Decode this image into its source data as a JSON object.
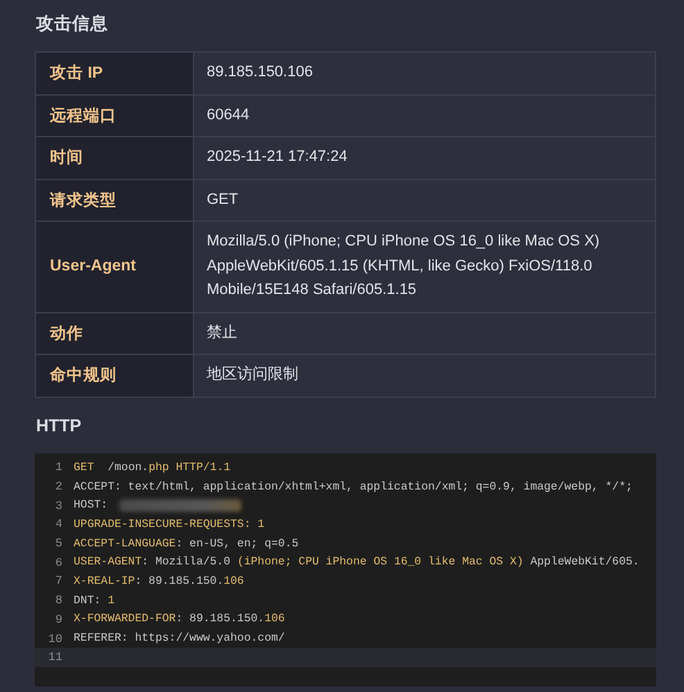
{
  "attack_info": {
    "title": "攻击信息",
    "rows": [
      {
        "label": "攻击 IP",
        "value": "89.185.150.106"
      },
      {
        "label": "远程端口",
        "value": "60644"
      },
      {
        "label": "时间",
        "value": "2025-11-21 17:47:24"
      },
      {
        "label": "请求类型",
        "value": "GET"
      },
      {
        "label": "User-Agent",
        "value": "Mozilla/5.0 (iPhone; CPU iPhone OS 16_0 like Mac OS X) AppleWebKit/605.1.15 (KHTML, like Gecko) FxiOS/118.0 Mobile/15E148 Safari/605.1.15"
      },
      {
        "label": "动作",
        "value": "禁止"
      },
      {
        "label": "命中规则",
        "value": "地区访问限制"
      }
    ]
  },
  "http": {
    "title": "HTTP",
    "lines": [
      {
        "number": "1",
        "current": false,
        "redacted": false,
        "segments": [
          {
            "text": "GET",
            "highlight": true
          },
          {
            "text": "  /moon.",
            "highlight": false
          },
          {
            "text": "php HTTP/1.1",
            "highlight": true
          }
        ]
      },
      {
        "number": "2",
        "current": false,
        "redacted": false,
        "segments": [
          {
            "text": "ACCEPT: text/html, application/xhtml+xml, application/xml; q=0.9, image/webp, */*;",
            "highlight": false
          }
        ]
      },
      {
        "number": "3",
        "current": false,
        "redacted": true,
        "segments": [
          {
            "text": "HOST:",
            "highlight": false
          }
        ]
      },
      {
        "number": "4",
        "current": false,
        "redacted": false,
        "segments": [
          {
            "text": "UPGRADE-INSECURE-REQUESTS: 1",
            "highlight": true
          }
        ]
      },
      {
        "number": "5",
        "current": false,
        "redacted": false,
        "segments": [
          {
            "text": "ACCEPT-LANGUAGE",
            "highlight": true
          },
          {
            "text": ": en-US, en; q=0.5",
            "highlight": false
          }
        ]
      },
      {
        "number": "6",
        "current": false,
        "redacted": false,
        "segments": [
          {
            "text": "USER-AGENT",
            "highlight": true
          },
          {
            "text": ": Mozilla/5.0 ",
            "highlight": false
          },
          {
            "text": "(iPhone; CPU iPhone OS 16_0 like Mac OS X)",
            "highlight": true
          },
          {
            "text": " AppleWebKit/605.",
            "highlight": false
          }
        ]
      },
      {
        "number": "7",
        "current": false,
        "redacted": false,
        "segments": [
          {
            "text": "X-REAL-IP",
            "highlight": true
          },
          {
            "text": ": 89.185.150.",
            "highlight": false
          },
          {
            "text": "106",
            "highlight": true
          }
        ]
      },
      {
        "number": "8",
        "current": false,
        "redacted": false,
        "segments": [
          {
            "text": "DNT: ",
            "highlight": false
          },
          {
            "text": "1",
            "highlight": true
          }
        ]
      },
      {
        "number": "9",
        "current": false,
        "redacted": false,
        "segments": [
          {
            "text": "X-FORWARDED-FOR",
            "highlight": true
          },
          {
            "text": ": 89.185.150.",
            "highlight": false
          },
          {
            "text": "106",
            "highlight": true
          }
        ]
      },
      {
        "number": "10",
        "current": false,
        "redacted": false,
        "segments": [
          {
            "text": "REFERER: https://www.yahoo.com/",
            "highlight": false
          }
        ]
      },
      {
        "number": "11",
        "current": true,
        "redacted": false
      }
    ]
  }
}
